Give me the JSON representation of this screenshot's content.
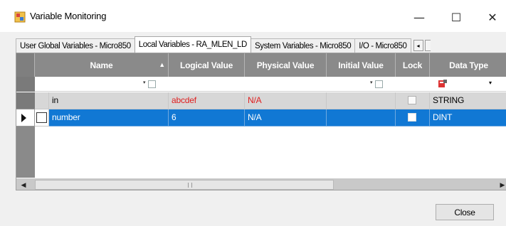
{
  "window": {
    "title": "Variable Monitoring",
    "minimize": "—",
    "maximize": "☐",
    "close": "✕"
  },
  "tabs": [
    {
      "label": "User Global Variables - Micro850",
      "active": false
    },
    {
      "label": "Local Variables - RA_MLEN_LD",
      "active": true
    },
    {
      "label": "System Variables - Micro850",
      "active": false
    },
    {
      "label": "I/O - Micro850",
      "active": false
    }
  ],
  "tab_scroll": "◂",
  "grid": {
    "columns": [
      "Name",
      "Logical Value",
      "Physical Value",
      "Initial Value",
      "Lock",
      "Data Type"
    ],
    "sort_indicator": "▲",
    "rows": [
      {
        "name": "in",
        "logical": "abcdef",
        "physical": "N/A",
        "initial": "",
        "lock": false,
        "data_type": "STRING",
        "selected": false
      },
      {
        "name": "number",
        "logical": "6",
        "physical": "N/A",
        "initial": "",
        "lock": false,
        "data_type": "DINT",
        "selected": true
      }
    ]
  },
  "scrollbar": {
    "left": "◀",
    "right": "▶"
  },
  "footer": {
    "close_label": "Close"
  },
  "colors": {
    "selection": "#1178d4",
    "header": "#8a8a8a",
    "error_text": "#e02020"
  }
}
